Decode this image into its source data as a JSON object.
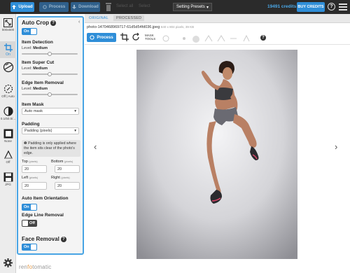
{
  "topbar": {
    "upload_label": "Upload",
    "process_label": "Process",
    "download_label": "Download",
    "dim_labels": [
      "Select all",
      "Select"
    ],
    "presets_label": "Setting Presets",
    "credits": "19491 credits",
    "buy_label": "BUY CREDITS",
    "help_label": "?"
  },
  "rail": {
    "resize_label": "500x600",
    "crop_state": "On",
    "super_cut_state": "",
    "edge_state": "Off | Auto",
    "contrast_label": "0.1/50.0/...",
    "background_label": "None",
    "shadow_label": "Off",
    "format_label": "JPG"
  },
  "panel": {
    "title": "Auto Crop",
    "auto_crop_toggle": "On",
    "item_detection": {
      "title": "Item Detection",
      "level_prefix": "Level:",
      "level": "Medium",
      "value": 0.5
    },
    "item_super_cut": {
      "title": "Item Super Cut",
      "level_prefix": "Level:",
      "level": "Medium",
      "value": 0.5
    },
    "edge_item_removal": {
      "title": "Edge Item Removal",
      "level_prefix": "Level:",
      "level": "Medium",
      "value": 0.5
    },
    "item_mask": {
      "title": "Item Mask",
      "selected": "Auto mask"
    },
    "padding": {
      "title": "Padding",
      "selected": "Padding (pixels)",
      "notice": "Padding is only applied where the item sits clear of the photo's edge.",
      "unit": "(pixels)",
      "top_label": "Top",
      "top_value": "20",
      "bottom_label": "Bottom",
      "bottom_value": "20",
      "left_label": "Left",
      "left_value": "20",
      "right_label": "Right",
      "right_value": "20"
    },
    "auto_item_orientation": {
      "title": "Auto Item Orientation",
      "state": "On"
    },
    "edge_line_removal": {
      "title": "Edge Line Removal",
      "state": "Off"
    },
    "face_removal": {
      "title": "Face Removal",
      "state": "On"
    }
  },
  "main": {
    "tab_original": "ORIGINAL",
    "tab_processed": "PROCESSED",
    "filename": "photo-1470468969717-61d5d54fd036.jpeg",
    "file_meta": "640 x 804 pixels, 39 KB",
    "process_label": "Process",
    "mask_tools_label": "MASK TOOLS",
    "help_label": "?"
  },
  "brand": {
    "name_a": "ren",
    "name_b": "fo",
    "name_c": "tomatic"
  },
  "colors": {
    "accent": "#2f8ed8",
    "panel_border": "#48a4e4",
    "topbar": "#2b2b2b"
  }
}
